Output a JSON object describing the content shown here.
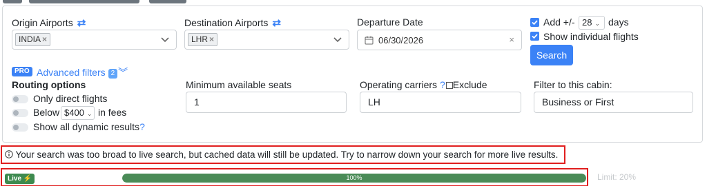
{
  "search_form": {
    "origin": {
      "label": "Origin Airports",
      "swap_icon": "swap-arrows-icon",
      "chip": "INDIA",
      "chip_remove": "×"
    },
    "destination": {
      "label": "Destination Airports",
      "swap_icon": "swap-arrows-icon",
      "chip": "LHR",
      "chip_remove": "×"
    },
    "departure": {
      "label": "Departure Date",
      "value": "06/30/2026",
      "clear": "×"
    },
    "options": {
      "add_prefix": "Add +/-",
      "days_value": "28",
      "add_suffix": "days",
      "show_individual": "Show individual flights",
      "search_button": "Search"
    }
  },
  "advanced": {
    "pro_badge": "PRO",
    "link": "Advanced filters",
    "count": "2",
    "routing": {
      "title": "Routing options",
      "direct": "Only direct flights",
      "below_prefix": "Below",
      "fee_value": "$400",
      "below_suffix": "in fees",
      "dynamic": "Show all dynamic results",
      "help": "?"
    },
    "seats": {
      "label": "Minimum available seats",
      "value": "1"
    },
    "carriers": {
      "label": "Operating carriers",
      "help": "?",
      "exclude": "Exclude",
      "value": "LH"
    },
    "cabin": {
      "label": "Filter to this cabin:",
      "value": "Business or First"
    }
  },
  "notice": {
    "icon": "info-circle-icon",
    "text": "Your search was too broad to live search, but cached data will still be updated. Try to narrow down your search for more live results."
  },
  "status": {
    "live_label": "Live",
    "bolt_icon": "lightning-bolt-icon",
    "progress_value": 100,
    "progress_text": "100%",
    "limit_text": "Limit: 20%"
  },
  "colors": {
    "primary": "#3b82f6",
    "success": "#4a8b57",
    "highlight_border": "#e01e1e"
  }
}
